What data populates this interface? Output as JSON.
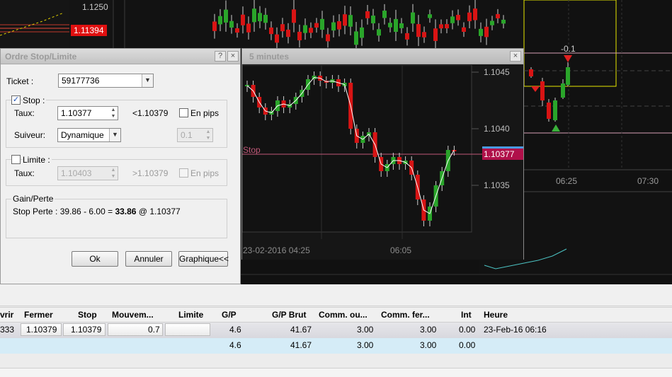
{
  "background_chart": {
    "price_top": "1.1250",
    "price_badge": "1.11394",
    "right_price_1": "1.1045",
    "right_price_2": "1.1040",
    "right_price_3": "1.1035",
    "right_badge": "1.10377",
    "delta_label": "-0.1",
    "time_1": "06:25",
    "time_2": "07:30"
  },
  "dialog": {
    "title": "Ordre Stop/Limite",
    "help_btn": "?",
    "close_btn": "×",
    "ticket_label": "Ticket :",
    "ticket_value": "59177736",
    "stop_label": "Stop :",
    "stop_checked": true,
    "rate_label": "Taux:",
    "stop_rate": "1.10377",
    "stop_hint": "<1.10379",
    "pips_label": "En pips",
    "trailing_label": "Suiveur:",
    "trailing_value": "Dynamique",
    "trailing_step": "0.1",
    "limit_label": "Limite :",
    "limit_rate_label": "Taux:",
    "limit_rate": "1.10403",
    "limit_hint": ">1.10379",
    "limit_pips_label": "En pips",
    "pl_label": "Gain/Perte",
    "pl_text_prefix": "Stop Perte : 39.86 - 6.00 = ",
    "pl_text_bold": "33.86",
    "pl_text_suffix": " @ 1.10377",
    "ok_btn": "Ok",
    "cancel_btn": "Annuler",
    "chart_btn": "Graphique<<"
  },
  "chart_window": {
    "title": "5 minutes",
    "close_btn": "×",
    "price_1": "1.1045",
    "price_2": "1.1040",
    "price_3": "1.1035",
    "stop_badge": "1.10377",
    "stop_label": "Stop",
    "date_label": "23-02-2016 04:25",
    "time_label": "06:05"
  },
  "positions": {
    "headers": [
      "vrir",
      "Fermer",
      "Stop",
      "Mouvem...",
      "Limite",
      "G/P",
      "G/P Brut",
      "Comm. ou...",
      "Comm. fer...",
      "Int",
      "Heure"
    ],
    "row1": {
      "open": "333",
      "close": "1.10379",
      "stop": "1.10379",
      "move": "0.7",
      "limit": "",
      "gp": "4.6",
      "gp_brut": "41.67",
      "comm_open": "3.00",
      "comm_close": "3.00",
      "int": "0.00",
      "time": "23-Feb-16 06:16"
    },
    "row2": {
      "gp": "4.6",
      "gp_brut": "41.67",
      "comm_open": "3.00",
      "comm_close": "3.00",
      "int": "0.00"
    }
  },
  "colors": {
    "up": "#2aa52a",
    "down": "#d81414",
    "stop_line": "#d0608a",
    "badge": "#e01010"
  }
}
